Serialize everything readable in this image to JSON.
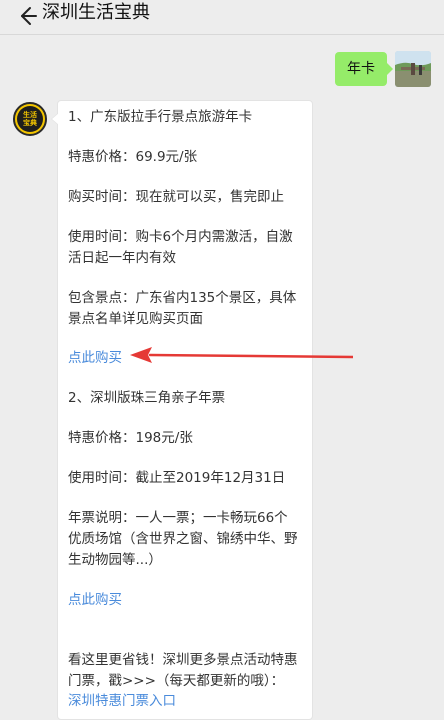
{
  "header": {
    "title": "深圳生活宝典"
  },
  "outgoing": {
    "text": "年卡"
  },
  "bot_avatar": {
    "line1": "生活",
    "line2": "宝典"
  },
  "message": {
    "item1_title": "1、广东版拉手行景点旅游年卡",
    "item1_price": "特惠价格：69.9元/张",
    "item1_buy_time": "购买时间：现在就可以买，售完即止",
    "item1_use_time_1": "使用时间：购卡6个月内需激活，自激",
    "item1_use_time_2": "活日起一年内有效",
    "item1_spots_1": "包含景点：广东省内135个景区，具体",
    "item1_spots_2": "景点名单详见购买页面",
    "item1_link": "点此购买",
    "item2_title": "2、深圳版珠三角亲子年票",
    "item2_price": "特惠价格：198元/张",
    "item2_use_time": "使用时间：截止至2019年12月31日",
    "item2_desc_1": "年票说明：一人一票；一卡畅玩66个",
    "item2_desc_2": "优质场馆（含世界之窗、锦绣中华、野",
    "item2_desc_3": "生动物园等...）",
    "item2_link": "点此购买",
    "footer_1": "看这里更省钱！深圳更多景点活动特惠",
    "footer_2": "门票，戳>>>（每天都更新的哦）：",
    "footer_link": "深圳特惠门票入口"
  },
  "colors": {
    "background": "#ededed",
    "outgoing_bubble": "#95ec69",
    "link": "#4a8bdb",
    "arrow": "#e53935"
  }
}
